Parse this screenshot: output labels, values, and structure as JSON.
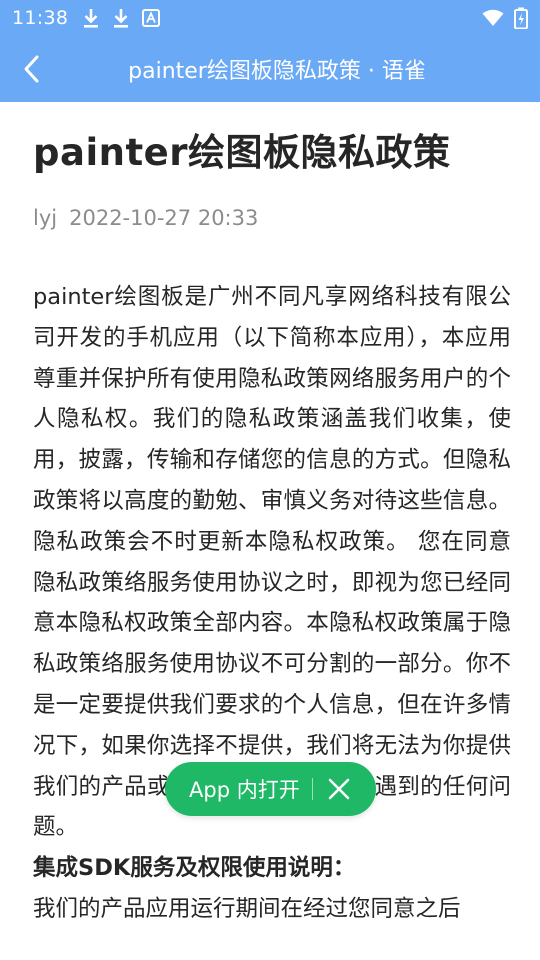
{
  "status_bar": {
    "time": "11:38",
    "left_icons": [
      "download-icon",
      "download-icon",
      "font-notification-icon"
    ],
    "right_icons": [
      "wifi-icon",
      "battery-icon"
    ]
  },
  "app_bar": {
    "title": "painter绘图板隐私政策 · 语雀",
    "back_icon": "chevron-left-icon",
    "color": "#6aa9f5"
  },
  "document": {
    "title": "painter绘图板隐私政策",
    "author": "lyj",
    "date": "2022-10-27 20:33",
    "paragraph_1": "painter绘图板是广州不同凡享网络科技有限公司开发的手机应用（以下简称本应用），本应用尊重并保护所有使用隐私政策网络服务用户的个人隐私权。我们的隐私政策涵盖我们收集，使用，披露，传输和存储您的信息的方式。但隐私政策将以高度的勤勉、审慎义务对待这些信息。隐私政策会不时更新本隐私权政策。 您在同意隐私政策络服务使用协议之时，即视为您已经同意本隐私权政策全部内容。本隐私权政策属于隐私政策络服务使用协议不可分割的一部分。你不是一定要提供我们要求的个人信息，但在许多情况下，如果你选择不提供，我们将无法为你提供我们的产品或服务，也无法回应你遇到的任何问题。",
    "section_heading": "集成SDK服务及权限使用说明：",
    "paragraph_2": "我们的产品应用运行期间在经过您同意之后"
  },
  "floating_button": {
    "label": "App 内打开",
    "close_icon": "close-icon",
    "color": "#1fb866"
  }
}
